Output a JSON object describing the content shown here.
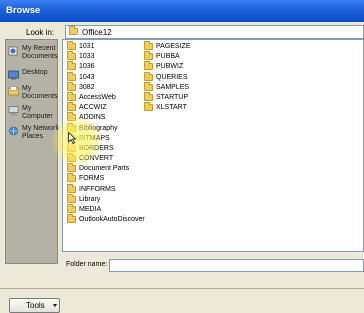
{
  "window": {
    "title": "Browse"
  },
  "lookin": {
    "label": "Look in:",
    "value": "Office12"
  },
  "places": [
    {
      "label": "My Recent Documents",
      "icon": "recent-documents-icon"
    },
    {
      "label": "Desktop",
      "icon": "desktop-icon"
    },
    {
      "label": "My Documents",
      "icon": "my-documents-icon"
    },
    {
      "label": "My Computer",
      "icon": "my-computer-icon"
    },
    {
      "label": "My Network Places",
      "icon": "network-places-icon"
    }
  ],
  "files": {
    "column1": [
      "1031",
      "1033",
      "1036",
      "1043",
      "3082",
      "AccessWeb",
      "ACCWIZ",
      "ADDINS",
      "Bibliography",
      "BITMAPS",
      "BORDERS",
      "CONVERT",
      "Document Parts",
      "FORMS",
      "INFFORMS",
      "Library",
      "MEDIA",
      "OutlookAutoDiscover"
    ],
    "column2": [
      "PAGESIZE",
      "PUBBA",
      "PUBWIZ",
      "QUERIES",
      "SAMPLES",
      "STARTUP",
      "XLSTART"
    ]
  },
  "filename": {
    "label": "Folder name:",
    "value": ""
  },
  "tools": {
    "label": "Tools"
  },
  "colors": {
    "titlebar": "#1d5fd8",
    "dialog": "#ece9d8",
    "folder": "#f1cc58",
    "highlight": "#fff478"
  }
}
